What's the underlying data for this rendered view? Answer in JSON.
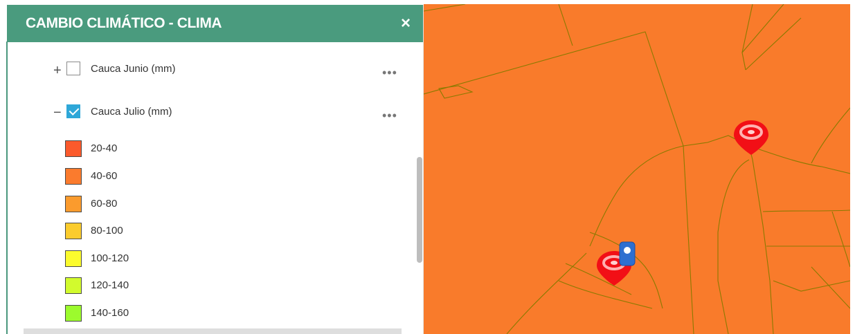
{
  "panel": {
    "title": "CAMBIO CLIMÁTICO - CLIMA",
    "close_label": "×"
  },
  "layers": [
    {
      "expander": "+",
      "label": "Cauca Junio (mm)",
      "checked": false,
      "more": "•••"
    },
    {
      "expander": "−",
      "label": "Cauca Julio (mm)",
      "checked": true,
      "more": "•••"
    }
  ],
  "legend": [
    {
      "label": "20-40",
      "color": "#fb5a2c"
    },
    {
      "label": "40-60",
      "color": "#fb7b2d"
    },
    {
      "label": "60-80",
      "color": "#fb9b2d"
    },
    {
      "label": "80-100",
      "color": "#fbcc2d"
    },
    {
      "label": "100-120",
      "color": "#fbfb2d"
    },
    {
      "label": "120-140",
      "color": "#d2fb2d"
    },
    {
      "label": "140-160",
      "color": "#9cfb2d"
    }
  ],
  "map": {
    "fill_color": "#f97b2b",
    "line_color": "#8a7a00",
    "markers": [
      "red-location-marker",
      "red-location-marker",
      "blue-location-pin"
    ]
  }
}
